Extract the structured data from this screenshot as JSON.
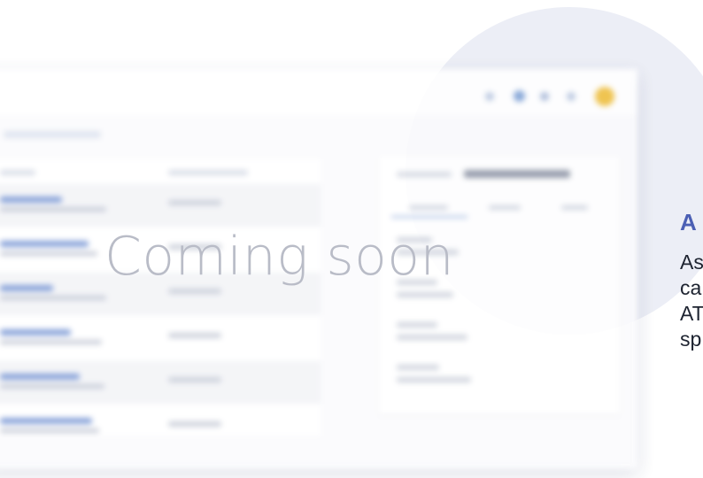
{
  "overlay": {
    "text": "Coming soon"
  },
  "side_content": {
    "heading": "A",
    "lines": [
      "As",
      "ca",
      "AT",
      "sp"
    ],
    "heading_color": "#4b5fb4"
  },
  "colors": {
    "background_circle": "#eceef6",
    "overlay_text": "#b9bcc7",
    "avatar": "#f0c040",
    "link_blue": "#7d9ad6"
  }
}
